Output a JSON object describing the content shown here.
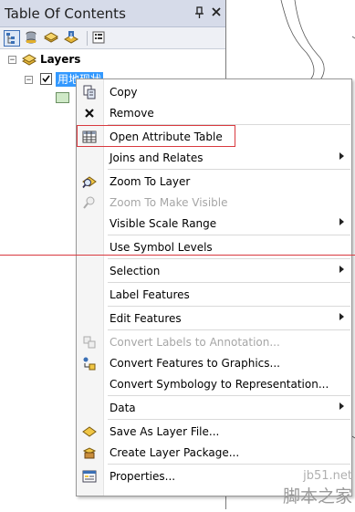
{
  "toc": {
    "title": "Table Of Contents",
    "pin_glyph": "ᵖ",
    "close_glyph": "✕",
    "toolbar": [
      "list-by-drawing-order-icon",
      "list-by-source-icon",
      "list-by-visibility-icon",
      "list-by-selection-icon",
      "options-icon"
    ],
    "layers_label": "Layers",
    "layer_name": "用地现状"
  },
  "menu": {
    "items": [
      {
        "label": "Copy",
        "icon": "copy-icon",
        "disabled": false,
        "submenu": false
      },
      {
        "label": "Remove",
        "icon": "remove-icon",
        "disabled": false,
        "submenu": false
      },
      {
        "label": "Open Attribute Table",
        "icon": "table-icon",
        "disabled": false,
        "submenu": false
      },
      {
        "label": "Joins and Relates",
        "icon": "",
        "disabled": false,
        "submenu": true
      },
      {
        "label": "Zoom To Layer",
        "icon": "zoom-to-layer-icon",
        "disabled": false,
        "submenu": false
      },
      {
        "label": "Zoom To Make Visible",
        "icon": "zoom-visible-icon",
        "disabled": true,
        "submenu": false
      },
      {
        "label": "Visible Scale Range",
        "icon": "",
        "disabled": false,
        "submenu": true
      },
      {
        "label": "Use Symbol Levels",
        "icon": "",
        "disabled": false,
        "submenu": false
      },
      {
        "label": "Selection",
        "icon": "",
        "disabled": false,
        "submenu": true
      },
      {
        "label": "Label Features",
        "icon": "",
        "disabled": false,
        "submenu": false
      },
      {
        "label": "Edit Features",
        "icon": "",
        "disabled": false,
        "submenu": true
      },
      {
        "label": "Convert Labels to Annotation...",
        "icon": "convert-labels-icon",
        "disabled": true,
        "submenu": false
      },
      {
        "label": "Convert Features to Graphics...",
        "icon": "convert-features-icon",
        "disabled": false,
        "submenu": false
      },
      {
        "label": "Convert Symbology to Representation...",
        "icon": "",
        "disabled": false,
        "submenu": false
      },
      {
        "label": "Data",
        "icon": "",
        "disabled": false,
        "submenu": true
      },
      {
        "label": "Save As Layer File...",
        "icon": "layer-file-icon",
        "disabled": false,
        "submenu": false
      },
      {
        "label": "Create Layer Package...",
        "icon": "layer-package-icon",
        "disabled": false,
        "submenu": false
      },
      {
        "label": "Properties...",
        "icon": "properties-icon",
        "disabled": false,
        "submenu": false
      }
    ]
  },
  "watermark": {
    "url": "jb51.net",
    "text": "脚本之家"
  },
  "colors": {
    "highlight": "#d9393f",
    "selection": "#3399ff"
  }
}
